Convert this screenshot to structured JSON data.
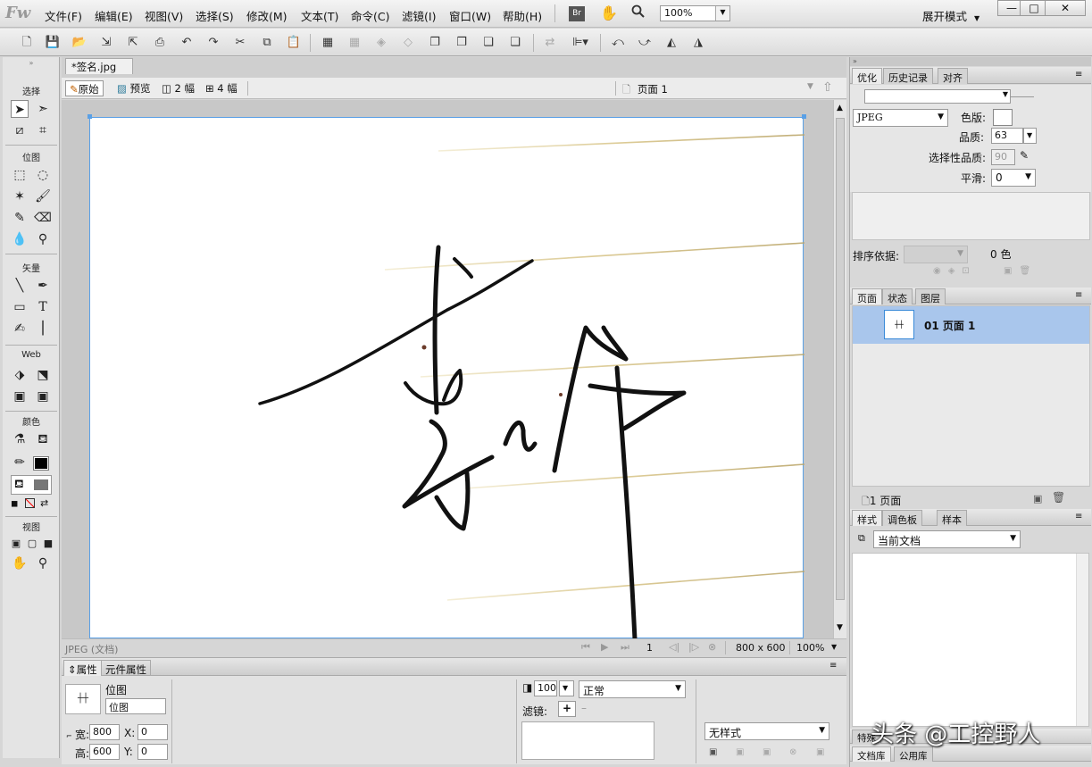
{
  "app": {
    "logo": "Fw",
    "zoom": "100%",
    "expand_mode": "展开模式",
    "br_label": "Br"
  },
  "menus": [
    "文件(F)",
    "编辑(E)",
    "视图(V)",
    "选择(S)",
    "修改(M)",
    "文本(T)",
    "命令(C)",
    "滤镜(I)",
    "窗口(W)",
    "帮助(H)"
  ],
  "window_controls": {
    "minimize": "—",
    "maximize": "□",
    "close": "✕"
  },
  "left_panel": {
    "sections": [
      "选择",
      "位图",
      "矢量",
      "Web",
      "颜色",
      "视图"
    ]
  },
  "document": {
    "tab_title": "*签名.jpg",
    "view_buttons": [
      "原始",
      "预览",
      "2 幅",
      "4 幅"
    ],
    "page_label": "页面 1",
    "status_type": "JPEG (文档)",
    "page_num": "1",
    "size": "800 x 600",
    "zoom": "100%"
  },
  "properties": {
    "tabs": [
      "属性",
      "元件属性"
    ],
    "object_type": "位图",
    "name_value": "位图",
    "width_label": "宽:",
    "width": "800",
    "height_label": "高:",
    "height": "600",
    "x_label": "X:",
    "x": "0",
    "y_label": "Y:",
    "y": "0",
    "opacity": "100",
    "blend": "正常",
    "filters_label": "滤镜:",
    "style": "无样式"
  },
  "optimize": {
    "tabs": [
      "优化",
      "历史记录",
      "对齐"
    ],
    "format": "JPEG",
    "matte_label": "色版:",
    "quality_label": "品质:",
    "quality": "63",
    "selective_label": "选择性品质:",
    "selective": "90",
    "smooth_label": "平滑:",
    "smooth": "0",
    "sort_label": "排序依据:",
    "colors": "0 色"
  },
  "pages": {
    "tabs": [
      "页面",
      "状态",
      "图层"
    ],
    "items": [
      {
        "label": "01 页面 1"
      }
    ],
    "footer": "1 页面"
  },
  "styles": {
    "tabs": [
      "样式",
      "调色板",
      "样本"
    ],
    "source": "当前文档",
    "bottom_tabs": [
      "特殊",
      "文档库",
      "公用库"
    ]
  },
  "watermark": "头条 @工控野人",
  "colors": {
    "selection": "#a9c6ec",
    "canvas_border": "#5aa0e6",
    "ink": "#111111"
  }
}
